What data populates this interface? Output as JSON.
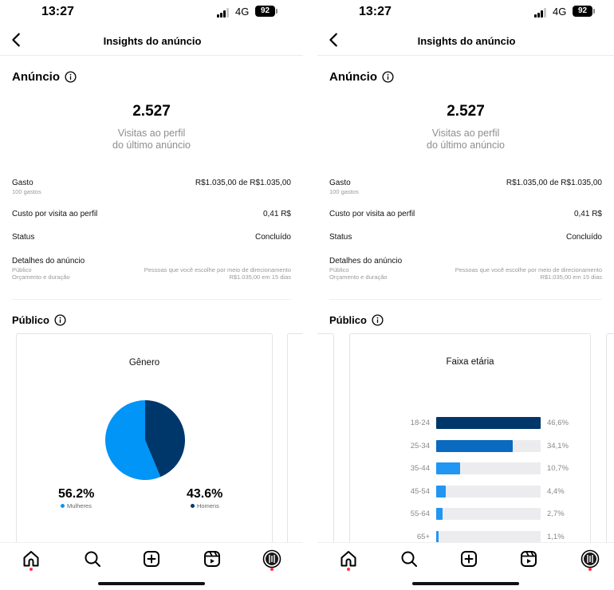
{
  "status_bar": {
    "time": "13:27",
    "network": "4G",
    "battery": "92"
  },
  "header": {
    "title": "Insights do anúncio"
  },
  "ad": {
    "section_title": "Anúncio",
    "visits": "2.527",
    "visits_caption_line1": "Visitas ao perfil",
    "visits_caption_line2": "do último anúncio",
    "spend_label": "Gasto",
    "spend_sub": "100 gastos",
    "spend_value": "R$1.035,00 de R$1.035,00",
    "cpv_label": "Custo por visita ao perfil",
    "cpv_value": "0,41 R$",
    "status_label": "Status",
    "status_value": "Concluído",
    "details_label": "Detalhes do anúncio",
    "details_sub1": "Público",
    "details_sub2": "Orçamento e duração",
    "details_val1": "Pessoas que você escolhe por meio de direcionamento",
    "details_val2": "R$1.035,00 em 15 dias"
  },
  "audience": {
    "section_title": "Público"
  },
  "gender_chart": {
    "title": "Gênero",
    "women_pct": "56.2%",
    "women_label": "Mulheres",
    "men_pct": "43.6%",
    "men_label": "Homens",
    "colors": {
      "women": "#0095f6",
      "men": "#00376b"
    }
  },
  "chart_data": [
    {
      "type": "pie",
      "title": "Gênero",
      "categories": [
        "Mulheres",
        "Homens"
      ],
      "values": [
        56.2,
        43.6
      ]
    },
    {
      "type": "bar",
      "title": "Faixa etária",
      "categories": [
        "18-24",
        "25-34",
        "35-44",
        "45-54",
        "55-64",
        "65+"
      ],
      "values": [
        46.6,
        34.1,
        10.7,
        4.4,
        2.7,
        1.1
      ],
      "value_labels": [
        "46,6%",
        "34,1%",
        "10,7%",
        "4,4%",
        "2,7%",
        "1,1%"
      ],
      "colors": [
        "#00376b",
        "#0a6ac0",
        "#2196f3",
        "#2196f3",
        "#2196f3",
        "#2196f3"
      ],
      "xlim": [
        0,
        100
      ]
    }
  ],
  "tabs": [
    {
      "icon": "home-icon",
      "notif": true
    },
    {
      "icon": "search-icon",
      "notif": false
    },
    {
      "icon": "create-icon",
      "notif": false
    },
    {
      "icon": "reels-icon",
      "notif": false
    },
    {
      "icon": "profile-icon",
      "notif": true
    }
  ]
}
